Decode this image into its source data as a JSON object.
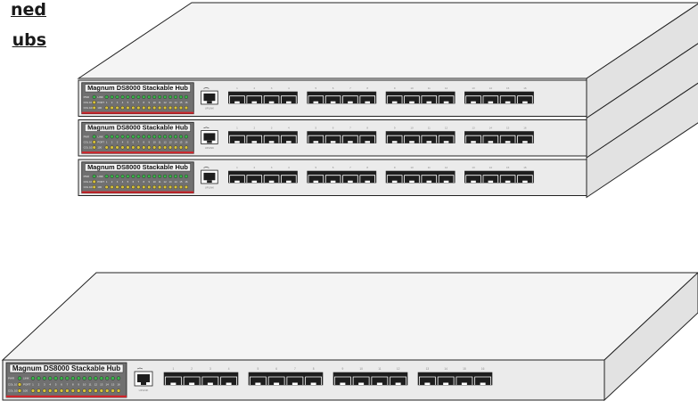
{
  "heading": {
    "line1": "ned",
    "line2": "ubs"
  },
  "hub": {
    "model_label": "Magnum DS8000 Stackable Hub",
    "led_left_labels": [
      "PWR",
      "COL 10",
      "COL 100"
    ],
    "led_row_labels": [
      "LINK",
      "PORT",
      "100"
    ],
    "port_numbers": [
      "1",
      "2",
      "3",
      "4",
      "5",
      "6",
      "7",
      "8",
      "9",
      "10",
      "11",
      "12",
      "13",
      "14",
      "15",
      "16"
    ],
    "uplink_label": "UPLINK"
  },
  "stacked_count": 3,
  "colors": {
    "chassis_face": "#ebebeb",
    "chassis_top": "#f4f4f4",
    "chassis_side": "#e2e2e2",
    "panel": "#707070",
    "panel_label_bg": "#f2f2f2",
    "led_green": "#3ab34a",
    "led_yellow": "#d8c23a",
    "red_strip": "#d0242a",
    "port_bank": "#1e1e1e",
    "outline": "#222222"
  }
}
